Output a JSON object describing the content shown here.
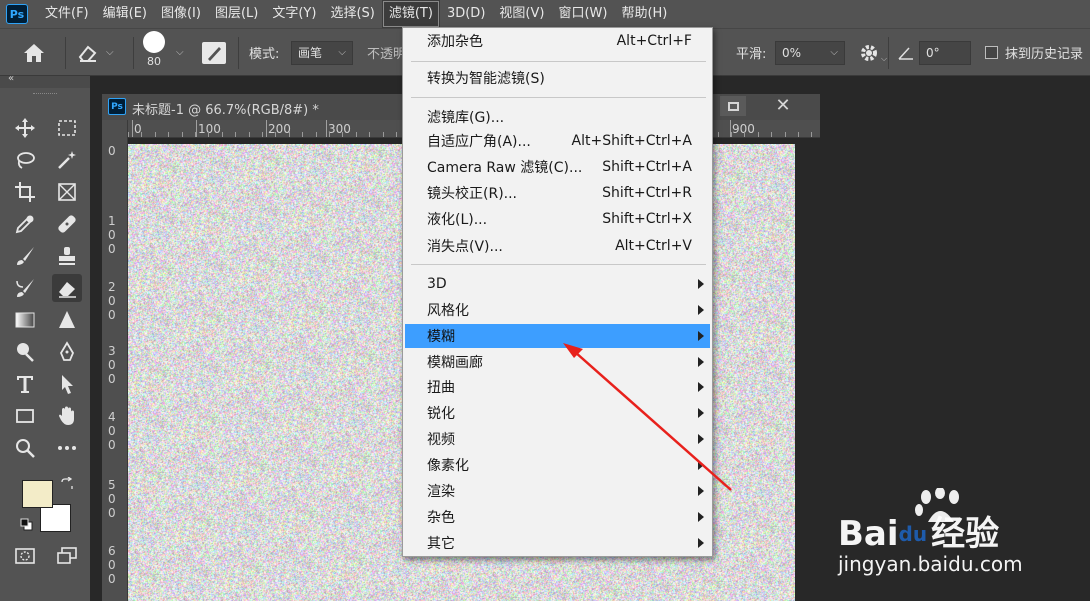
{
  "app": {
    "logo": "Ps"
  },
  "menubar": {
    "items": [
      "文件(F)",
      "编辑(E)",
      "图像(I)",
      "图层(L)",
      "文字(Y)",
      "选择(S)",
      "滤镜(T)",
      "3D(D)",
      "视图(V)",
      "窗口(W)",
      "帮助(H)"
    ],
    "open_index": 6
  },
  "options": {
    "brush_size": "80",
    "mode_label": "模式:",
    "mode_value": "画笔",
    "opacity_label": "不透明",
    "smooth_label": "平滑:",
    "smooth_value": "0%",
    "angle_value": "0°",
    "history_label": "抹到历史记录"
  },
  "document": {
    "title": "未标题-1 @ 66.7%(RGB/8#) *",
    "ruler_h": [
      "0",
      "100",
      "200",
      "300",
      "900"
    ],
    "ruler_v": [
      "0",
      "100",
      "200",
      "300",
      "400",
      "500",
      "600"
    ]
  },
  "colors": {
    "foreground": "#f3ecc8",
    "background": "#ffffff",
    "highlight": "#3d9eff",
    "menubar": "#535353"
  },
  "filter_menu": {
    "top": [
      {
        "label": "添加杂色",
        "shortcut": "Alt+Ctrl+F"
      }
    ],
    "convert": {
      "label": "转换为智能滤镜(S)"
    },
    "filters": [
      {
        "label": "滤镜库(G)...",
        "shortcut": ""
      },
      {
        "label": "自适应广角(A)...",
        "shortcut": "Alt+Shift+Ctrl+A"
      },
      {
        "label": "Camera Raw 滤镜(C)...",
        "shortcut": "Shift+Ctrl+A"
      },
      {
        "label": "镜头校正(R)...",
        "shortcut": "Shift+Ctrl+R"
      },
      {
        "label": "液化(L)...",
        "shortcut": "Shift+Ctrl+X"
      },
      {
        "label": "消失点(V)...",
        "shortcut": "Alt+Ctrl+V"
      }
    ],
    "submenus": [
      {
        "label": "3D"
      },
      {
        "label": "风格化"
      },
      {
        "label": "模糊",
        "highlighted": true
      },
      {
        "label": "模糊画廊"
      },
      {
        "label": "扭曲"
      },
      {
        "label": "锐化"
      },
      {
        "label": "视频"
      },
      {
        "label": "像素化"
      },
      {
        "label": "渲染"
      },
      {
        "label": "杂色"
      },
      {
        "label": "其它"
      }
    ]
  },
  "watermark": {
    "brand_left": "Bai",
    "brand_paw": "du",
    "brand_cn": "经验",
    "url": "jingyan.baidu.com"
  }
}
